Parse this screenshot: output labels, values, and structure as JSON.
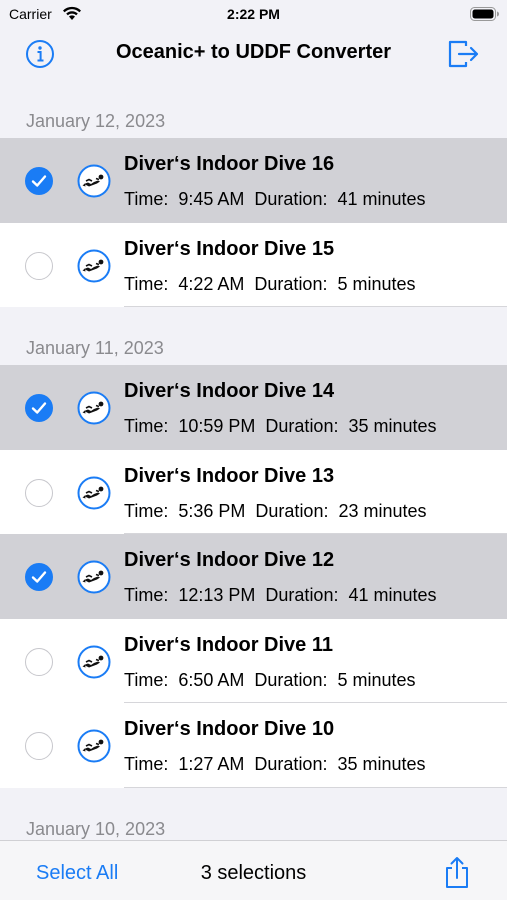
{
  "status_bar": {
    "carrier": "Carrier",
    "time": "2:22 PM"
  },
  "nav": {
    "title": "Oceanic+ to UDDF Converter",
    "left_icon": "info-circle-icon",
    "right_icon": "logout-icon"
  },
  "sections": [
    {
      "header": "January 12, 2023",
      "dives": [
        {
          "title": "Diver‘s Indoor Dive 16",
          "time_label": "Time:",
          "time": "9:45 AM",
          "duration_label": "Duration:",
          "duration": "41 minutes",
          "selected": true
        },
        {
          "title": "Diver‘s Indoor Dive 15",
          "time_label": "Time:",
          "time": "4:22 AM",
          "duration_label": "Duration:",
          "duration": "5 minutes",
          "selected": false
        }
      ]
    },
    {
      "header": "January 11, 2023",
      "dives": [
        {
          "title": "Diver‘s Indoor Dive 14",
          "time_label": "Time:",
          "time": "10:59 PM",
          "duration_label": "Duration:",
          "duration": "35 minutes",
          "selected": true
        },
        {
          "title": "Diver‘s Indoor Dive 13",
          "time_label": "Time:",
          "time": "5:36 PM",
          "duration_label": "Duration:",
          "duration": "23 minutes",
          "selected": false
        },
        {
          "title": "Diver‘s Indoor Dive 12",
          "time_label": "Time:",
          "time": "12:13 PM",
          "duration_label": "Duration:",
          "duration": "41 minutes",
          "selected": true
        },
        {
          "title": "Diver‘s Indoor Dive 11",
          "time_label": "Time:",
          "time": "6:50 AM",
          "duration_label": "Duration:",
          "duration": "5 minutes",
          "selected": false
        },
        {
          "title": "Diver‘s Indoor Dive 10",
          "time_label": "Time:",
          "time": "1:27 AM",
          "duration_label": "Duration:",
          "duration": "35 minutes",
          "selected": false
        }
      ]
    },
    {
      "header": "January 10, 2023",
      "dives": []
    }
  ],
  "toolbar": {
    "select_all": "Select All",
    "selection_count": "3 selections",
    "share_icon": "share-icon"
  },
  "colors": {
    "accent": "#1a7cf5",
    "selected_row": "#d1d1d6",
    "background": "#f2f2f7",
    "section_header": "#8a8a8e"
  }
}
